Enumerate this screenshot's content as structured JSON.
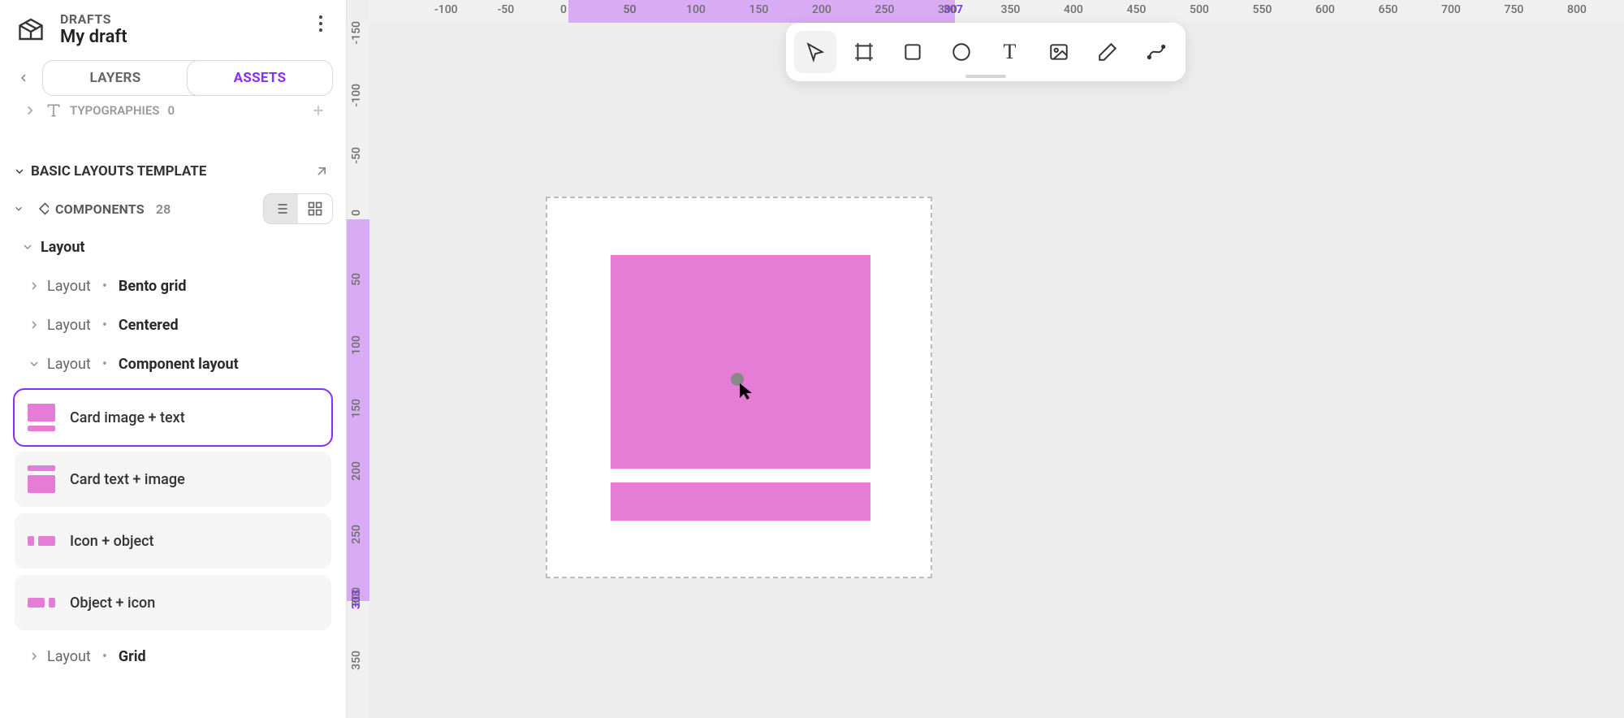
{
  "header": {
    "breadcrumb": "DRAFTS",
    "title": "My draft"
  },
  "tabs": {
    "layers": "LAYERS",
    "assets": "ASSETS"
  },
  "truncated": {
    "label": "TYPOGRAPHIES",
    "count": "0"
  },
  "library": {
    "title": "BASIC LAYOUTS TEMPLATE"
  },
  "components": {
    "label": "COMPONENTS",
    "count": "28",
    "groups": {
      "root": "Layout",
      "g1_prefix": "Layout",
      "g1_name": "Bento grid",
      "g2_prefix": "Layout",
      "g2_name": "Centered",
      "g3_prefix": "Layout",
      "g3_name": "Component layout",
      "g4_prefix": "Layout",
      "g4_name": "Grid"
    },
    "cards": {
      "c1": "Card image + text",
      "c2": "Card text + image",
      "c3": "Icon + object",
      "c4": "Object + icon"
    }
  },
  "ruler": {
    "top": [
      "50",
      "-100",
      "-50",
      "0",
      "50",
      "100",
      "150",
      "200",
      "250",
      "300",
      "350",
      "400",
      "450",
      "500",
      "550",
      "600",
      "650",
      "700",
      "750",
      "800"
    ],
    "left": [
      "-150",
      "-100",
      "-50",
      "0",
      "50",
      "100",
      "150",
      "200",
      "250",
      "300",
      "350"
    ],
    "cursorX": "307",
    "cursorY": "303",
    "hlX": {
      "from": "0",
      "to": "307"
    },
    "hlY": {
      "from": "0",
      "to": "303"
    }
  },
  "colors": {
    "accent": "#8630ff",
    "componentFill": "#e57dd6",
    "rulerHighlight": "#d9abf5"
  },
  "toolbar": {
    "pointer": "pointer",
    "frame": "frame",
    "rectangle": "rectangle",
    "ellipse": "ellipse",
    "text": "text",
    "image": "image",
    "pen": "pen",
    "curve": "curve"
  }
}
